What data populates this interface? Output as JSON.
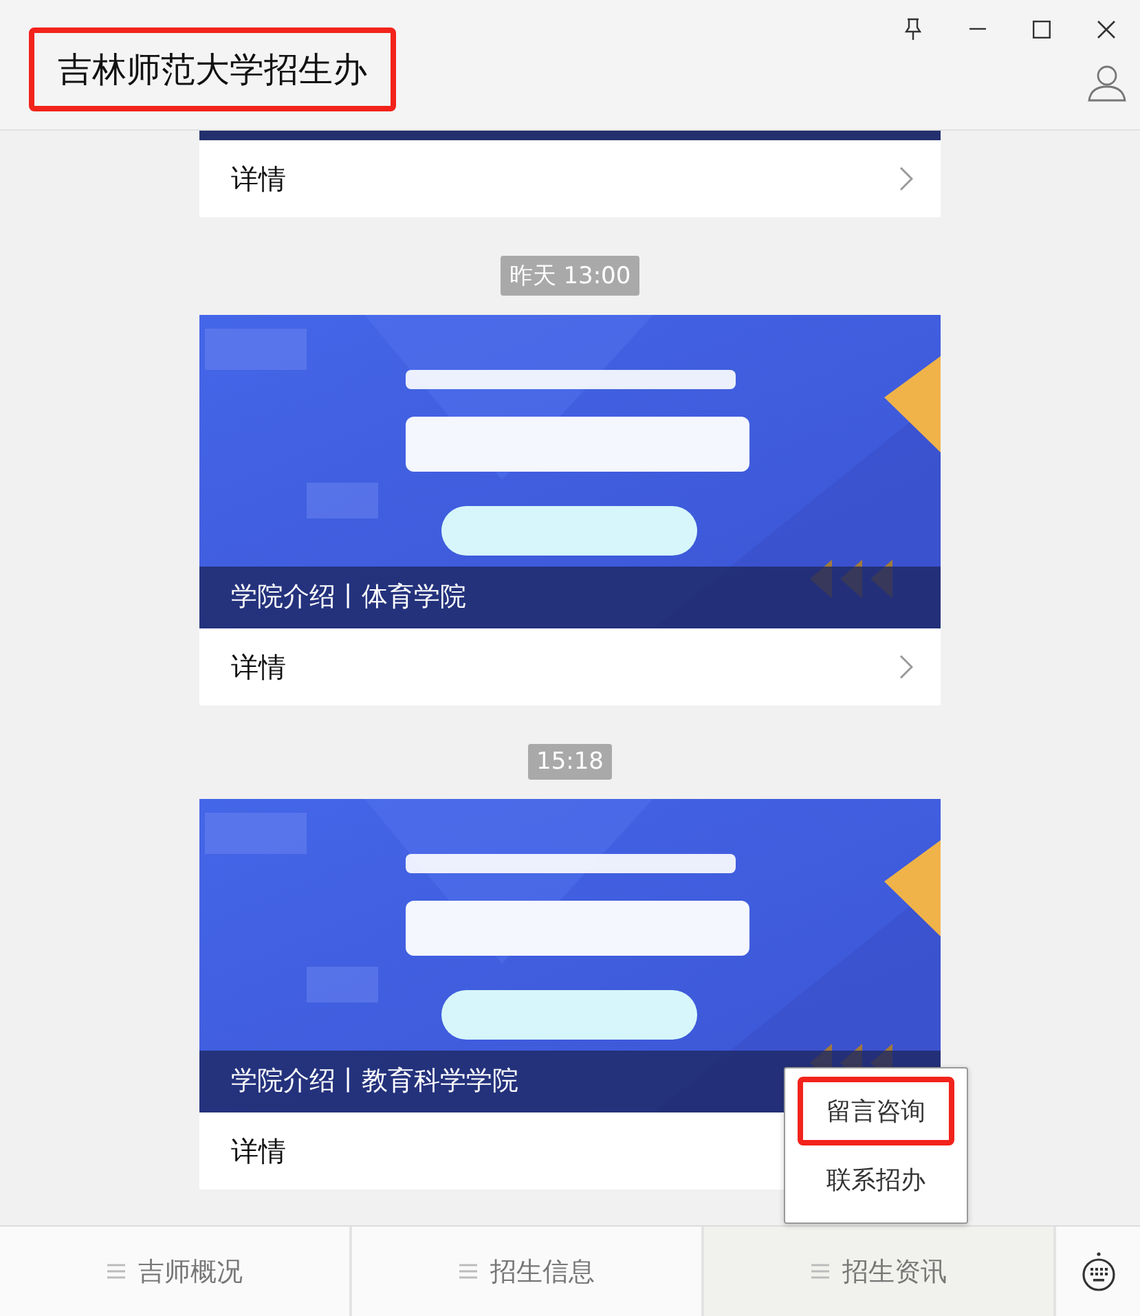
{
  "window": {
    "title": "吉林师范大学招生办",
    "title_highlighted": true
  },
  "feed": [
    {
      "kind": "article",
      "cropped": true,
      "link": "详情"
    },
    {
      "kind": "time",
      "text": "昨天 13:00"
    },
    {
      "kind": "article",
      "cropped": false,
      "caption": "学院介绍丨体育学院",
      "link": "详情"
    },
    {
      "kind": "time",
      "text": "15:18"
    },
    {
      "kind": "article",
      "cropped": false,
      "caption": "学院介绍丨教育科学学院",
      "link": "详情"
    }
  ],
  "menu_tabs": [
    {
      "label": "吉师概况",
      "selected": false
    },
    {
      "label": "招生信息",
      "selected": false
    },
    {
      "label": "招生资讯",
      "selected": true,
      "expanded": true,
      "submenu": [
        {
          "label": "留言咨询",
          "highlighted": true
        },
        {
          "label": "联系招办",
          "highlighted": false
        }
      ]
    }
  ]
}
